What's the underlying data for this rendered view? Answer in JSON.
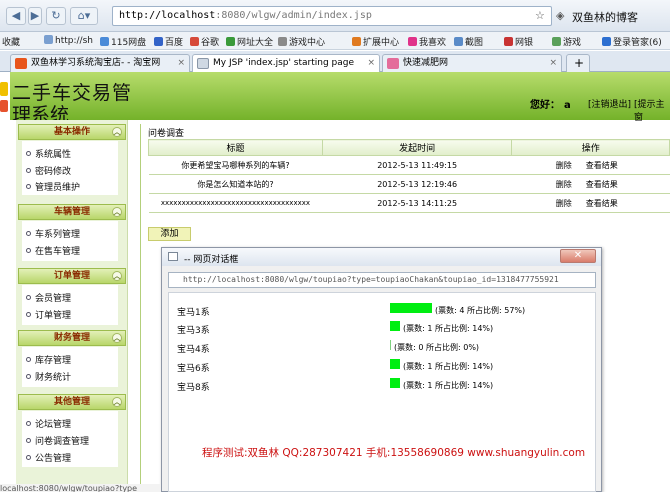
{
  "browser": {
    "url_host": "http://localhost",
    "url_rest": ":8080/wlgw/admin/index.jsp",
    "right_label": "双鱼林的博客",
    "bookmarks": [
      "收藏",
      "http://sh",
      "115网盘",
      "百度",
      "谷歌",
      "网址大全",
      "游戏中心",
      "扩展中心",
      "我喜欢",
      "截图",
      "网银",
      "游戏",
      "登录管家(6)"
    ],
    "tabs": [
      "双鱼林学习系统淘宝店- - 淘宝网",
      "My JSP 'index.jsp' starting page",
      "快速减肥网"
    ],
    "status_text": "localhost:8080/wlgw/toupiao?type"
  },
  "header": {
    "title_line1": "二手车交易管",
    "title_line2": "理系统",
    "greeting": "您好：",
    "username": "a",
    "logout": "[注销退出]",
    "hint": "[提示主窗"
  },
  "sidebar": {
    "sections": [
      {
        "title": "基本操作",
        "items": [
          "系统属性",
          "密码修改",
          "管理员维护"
        ]
      },
      {
        "title": "车辆管理",
        "items": [
          "车系列管理",
          "在售车管理"
        ]
      },
      {
        "title": "订单管理",
        "items": [
          "会员管理",
          "订单管理"
        ]
      },
      {
        "title": "财务管理",
        "items": [
          "库存管理",
          "财务统计"
        ]
      },
      {
        "title": "其他管理",
        "items": [
          "论坛管理",
          "问卷调查管理",
          "公告管理"
        ]
      }
    ]
  },
  "survey": {
    "section_title": "问卷调查",
    "columns": [
      "标题",
      "发起时间",
      "操作"
    ],
    "rows": [
      {
        "title": "你更希望宝马哪种系列的车辆?",
        "time": "2012-5-13 11:49:15",
        "delete": "删除",
        "view": "查看结果"
      },
      {
        "title": "你是怎么知道本站的?",
        "time": "2012-5-13 12:19:46",
        "delete": "删除",
        "view": "查看结果"
      },
      {
        "title": "xxxxxxxxxxxxxxxxxxxxxxxxxxxxxxxxxxxx",
        "time": "2012-5-13 14:11:25",
        "delete": "删除",
        "view": "查看结果"
      }
    ],
    "add_label": "添加"
  },
  "dialog": {
    "title": "-- 网页对话框",
    "url": "http://localhost:8080/wlgw/toupiao?type=toupiaoChakan&toupiao_id=1318477755921",
    "results": [
      {
        "name": "宝马1系",
        "votes_text": "(票数: 4   所占比例: 57%)",
        "percent": 57
      },
      {
        "name": "宝马3系",
        "votes_text": "(票数: 1   所占比例: 14%)",
        "percent": 14
      },
      {
        "name": "宝马4系",
        "votes_text": "(票数: 0   所占比例: 0%)",
        "percent": 0
      },
      {
        "name": "宝马6系",
        "votes_text": "(票数: 1   所占比例: 14%)",
        "percent": 14
      },
      {
        "name": "宝马8系",
        "votes_text": "(票数: 1   所占比例: 14%)",
        "percent": 14
      }
    ],
    "footer_note": "程序测试:双鱼林 QQ:287307421 手机:13558690869 www.shuangyulin.com"
  },
  "colors": {
    "header_green": "#74b22a",
    "bar_green": "#00ee11",
    "menu_title": "#8a2b00",
    "note_red": "#cc1111"
  }
}
